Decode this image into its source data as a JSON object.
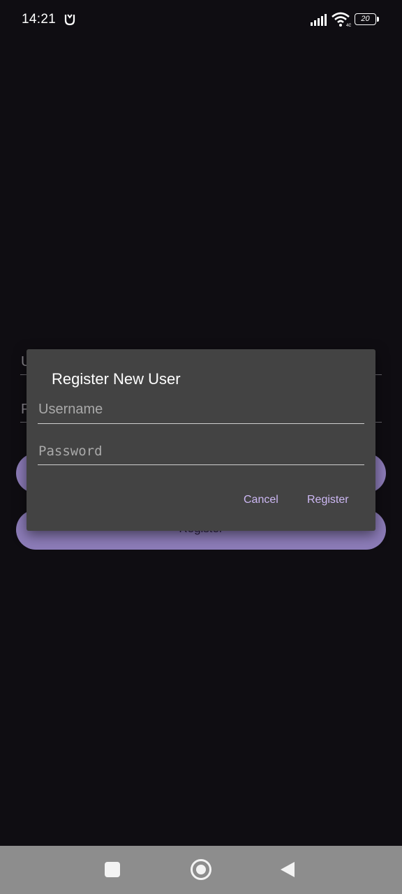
{
  "status_bar": {
    "time": "14:21",
    "battery_level": "20",
    "icons": [
      "mi-icon",
      "signal-icon",
      "wifi-icon",
      "battery-icon"
    ]
  },
  "background_form": {
    "username_hint": "U",
    "password_hint": "P",
    "register_button_label": "Register"
  },
  "dialog": {
    "title": "Register New User",
    "username_placeholder": "Username",
    "password_placeholder": "Password",
    "cancel_label": "Cancel",
    "register_label": "Register"
  },
  "nav_bar": {
    "icons": [
      "recents-icon",
      "home-icon",
      "back-icon"
    ]
  },
  "colors": {
    "background": "#0f0d12",
    "dialog": "#434343",
    "accent": "#cdb8f4",
    "button_fill": "#8c7cb8"
  }
}
